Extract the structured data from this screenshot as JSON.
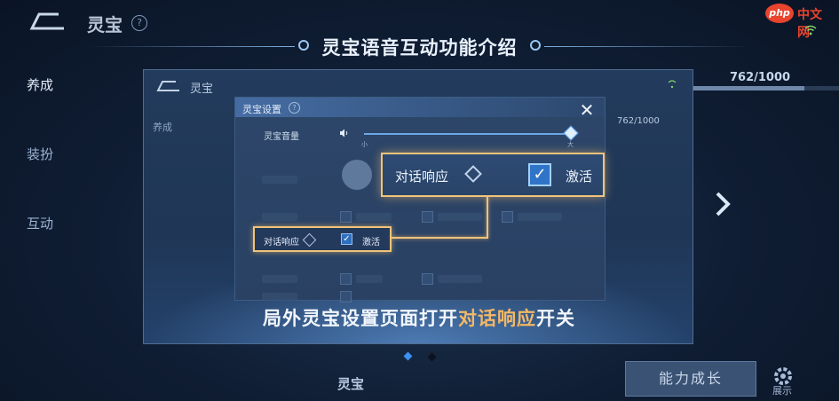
{
  "background": {
    "title": "灵宝",
    "help": "?",
    "side_menu": [
      "养成",
      "装扮",
      "互动"
    ],
    "score": "762/1000",
    "score_fraction": 0.762,
    "grow_button": "能力成长",
    "show_label": "展示",
    "bottom_name": "灵宝"
  },
  "watermark": {
    "badge": "php",
    "text": "中文网"
  },
  "intro": {
    "title": "灵宝语音互动功能介绍"
  },
  "panel": {
    "inner_title": "灵宝",
    "inner_side": "养成",
    "inner_score": "762/1000",
    "settings": {
      "title": "灵宝设置",
      "help": "?",
      "volume_label": "灵宝音量",
      "volume_min": "小",
      "volume_max": "大",
      "volume_level": 1.0,
      "row_label": "对话响应",
      "row_activate": "激活",
      "row_checked": true
    },
    "callout": {
      "label": "对话响应",
      "activate": "激活",
      "checked": true
    },
    "caption_parts": [
      "局外灵宝设置页面打开",
      "对话响应",
      "开关"
    ],
    "caption_highlight_color": "#f4b866"
  },
  "pagination": {
    "count": 2,
    "active": 0
  },
  "icons": [
    "back-icon",
    "help-icon",
    "close-icon",
    "speaker-icon",
    "checkbox-icon",
    "chevron-right-icon",
    "gear-icon",
    "wifi-icon"
  ]
}
